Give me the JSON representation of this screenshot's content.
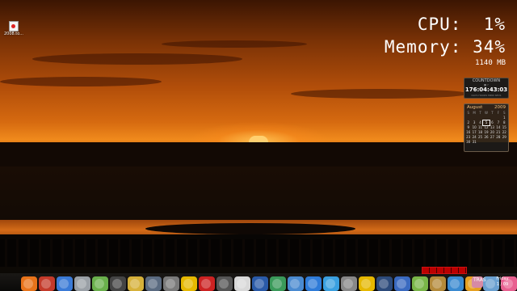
{
  "desktop": {
    "icon_label": "2008.to..."
  },
  "system_meter": {
    "cpu_label": "CPU:",
    "cpu_value": "1%",
    "memory_label": "Memory:",
    "memory_value": "34%",
    "memory_mb": "1140 MB"
  },
  "countdown": {
    "title": "COUNTDOWN",
    "subtitle": "■ 7",
    "units": "DAYS HOURS MINS SECS",
    "value": "176:04:43:03"
  },
  "calendar": {
    "month": "August",
    "year": "2009",
    "weekdays": [
      "S",
      "M",
      "T",
      "W",
      "T",
      "F",
      "S"
    ],
    "days": [
      "",
      "",
      "",
      "",
      "",
      "",
      "1",
      "2",
      "3",
      "4",
      "5",
      "6",
      "7",
      "8",
      "9",
      "10",
      "11",
      "12",
      "13",
      "14",
      "15",
      "16",
      "17",
      "18",
      "19",
      "20",
      "21",
      "22",
      "23",
      "24",
      "25",
      "26",
      "27",
      "28",
      "29",
      "30",
      "31",
      "",
      "",
      "",
      "",
      ""
    ],
    "today": "5"
  },
  "taskbar": {
    "dock_icons": [
      "firefox-icon",
      "media-icon",
      "messenger-icon",
      "drive-icon",
      "apple-icon",
      "app-icon",
      "star-icon",
      "gear-icon",
      "wrench-icon",
      "road-sign-icon",
      "red-circle-icon",
      "folder-icon",
      "document-icon",
      "word-icon",
      "app2-icon",
      "jellyfish-icon",
      "bird-icon",
      "globe-icon",
      "search-icon",
      "app3-icon",
      "display-icon",
      "info-icon",
      "cube-icon",
      "folder2-icon",
      "ie-icon",
      "ring-icon",
      "box-icon",
      "flower-icon"
    ],
    "trash_label": "TRAS",
    "clock_lines": [
      "Friday",
      "1 / 09"
    ]
  }
}
